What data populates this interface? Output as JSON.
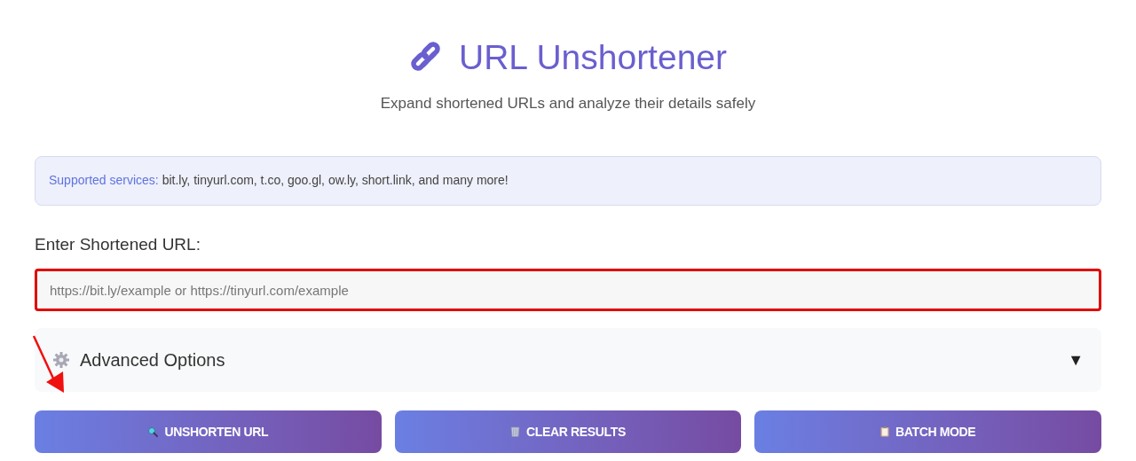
{
  "header": {
    "title": "URL Unshortener",
    "subtitle": "Expand shortened URLs and analyze their details safely"
  },
  "info": {
    "label": "Supported services:",
    "text": "bit.ly, tinyurl.com, t.co, goo.gl, ow.ly, short.link, and many more!"
  },
  "url_field": {
    "label": "Enter Shortened URL:",
    "placeholder": "https://bit.ly/example or https://tinyurl.com/example",
    "highlighted": true
  },
  "advanced": {
    "title": "Advanced Options",
    "toggle": "▼"
  },
  "annotation_arrow": true,
  "buttons": [
    {
      "label": "UNSHORTEN URL",
      "kind": "search"
    },
    {
      "label": "CLEAR RESULTS",
      "kind": "trash"
    },
    {
      "label": "BATCH MODE",
      "kind": "clipboard"
    }
  ]
}
